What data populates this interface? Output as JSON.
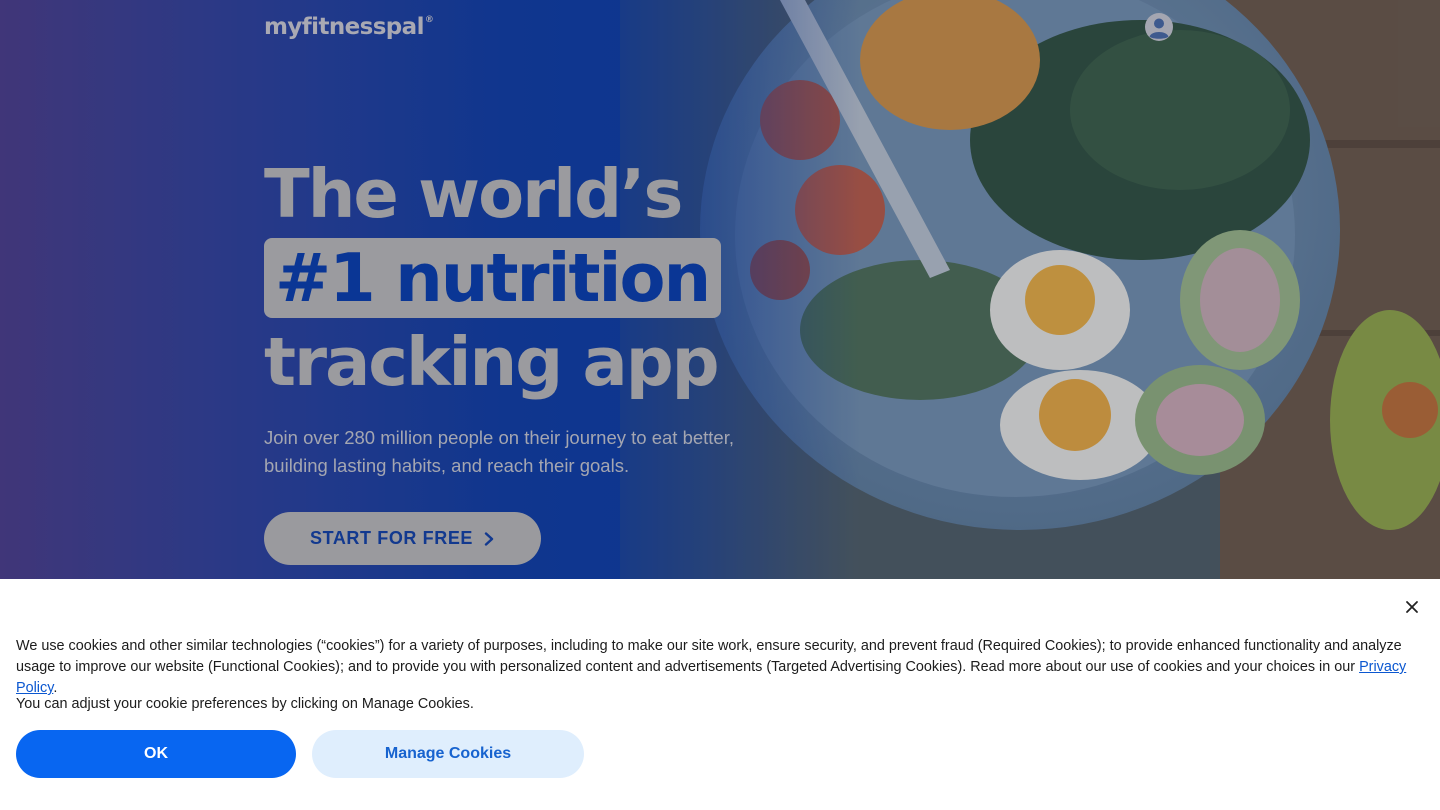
{
  "header": {
    "logo_text": "myfitnesspal",
    "logo_mark": "®",
    "account_icon": "user-account-icon"
  },
  "hero": {
    "headline_line1": "The world’s",
    "headline_highlight": "#1 nutrition",
    "headline_line3": "tracking app",
    "subtext": "Join over 280 million people on their journey to eat better, building lasting habits, and reach their goals.",
    "cta_label": "START FOR FREE",
    "cta_icon": "chevron-right-icon",
    "image": "salad-bowl-with-eggs-avocado-and-greens"
  },
  "cookie_banner": {
    "text_before_link": "We use cookies and other similar technologies (“cookies”) for a variety of purposes, including to make our site work, ensure security, and prevent fraud (Required Cookies); to provide enhanced functionality and analyze usage to improve our website (Functional Cookies); and to provide you with personalized content and advertisements (Targeted Advertising Cookies). Read more about our use of cookies and your choices in our ",
    "link_text": "Privacy Policy",
    "text_after_link": ".",
    "adjust_text": "You can adjust your cookie preferences by clicking on Manage Cookies.",
    "ok_label": "OK",
    "manage_label": "Manage Cookies",
    "close_icon": "close-icon"
  },
  "colors": {
    "brand_blue": "#0866f1",
    "manage_bg": "#dfeefd",
    "hero_blue": "#0b3a9c"
  }
}
